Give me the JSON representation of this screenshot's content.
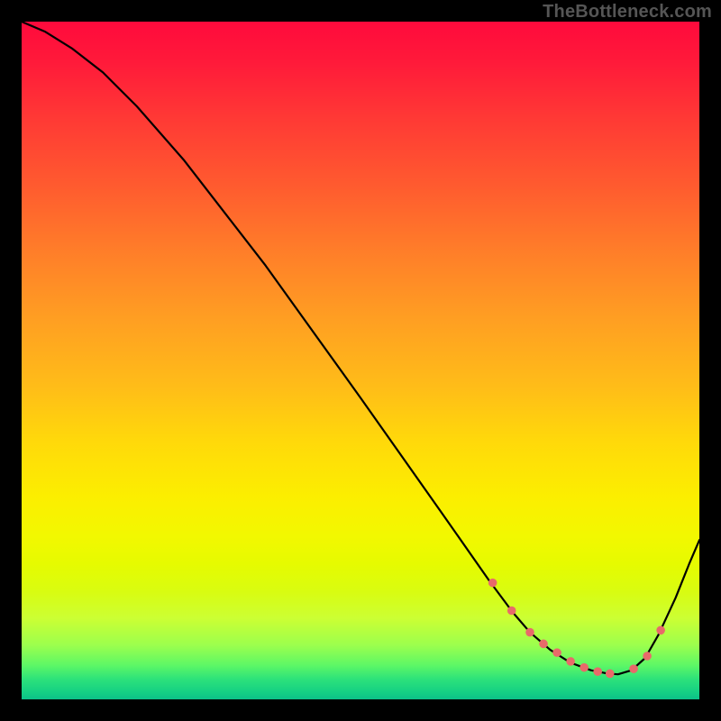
{
  "watermark": "TheBottleneck.com",
  "colors": {
    "gradient_top": "#ff0a3c",
    "gradient_mid": "#ffd90a",
    "gradient_bottom": "#0cc088",
    "curve": "#000000",
    "marker": "#e86a6a",
    "frame": "#000000"
  },
  "chart_data": {
    "type": "line",
    "title": "",
    "xlabel": "",
    "ylabel": "",
    "xlim": [
      0,
      100
    ],
    "ylim": [
      0,
      100
    ],
    "note": "x and y are normalized 0–100 percent of inner plot width/height; y=0 is the bottom. No tick labels are visible in the image.",
    "series": [
      {
        "name": "curve",
        "x": [
          0.0,
          3.5,
          7.5,
          12.0,
          17.0,
          24.0,
          36.0,
          50.0,
          62.0,
          69.0,
          72.5,
          75.0,
          78.0,
          81.0,
          84.0,
          86.5,
          88.0,
          90.0,
          92.0,
          94.0,
          96.5,
          98.5,
          100.0
        ],
        "y": [
          100.0,
          98.5,
          96.0,
          92.5,
          87.5,
          79.5,
          64.0,
          44.5,
          27.5,
          17.5,
          12.8,
          9.9,
          7.3,
          5.4,
          4.3,
          3.8,
          3.7,
          4.3,
          6.1,
          9.6,
          15.0,
          20.0,
          23.5
        ]
      }
    ],
    "markers": {
      "name": "highlight-points",
      "x": [
        69.5,
        72.3,
        75.0,
        77.0,
        79.0,
        81.0,
        83.0,
        85.0,
        86.8,
        90.3,
        92.3,
        94.3
      ],
      "y": [
        17.2,
        13.1,
        9.9,
        8.2,
        6.9,
        5.6,
        4.7,
        4.1,
        3.8,
        4.5,
        6.4,
        10.2
      ],
      "r": 4.8
    }
  }
}
